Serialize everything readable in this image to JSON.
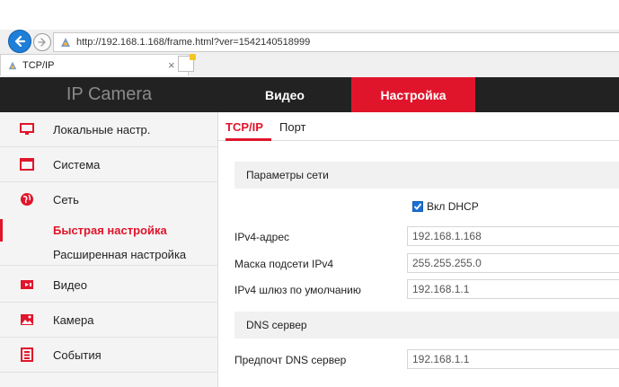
{
  "browser": {
    "address": "http://192.168.1.168/frame.html?ver=1542140518999",
    "tab_title": "TCP/IP",
    "tab_close": "×"
  },
  "header": {
    "brand": "IP Camera",
    "nav": [
      {
        "label": "Видео"
      },
      {
        "label": "Настройка"
      }
    ]
  },
  "sidebar": {
    "items": [
      {
        "label": "Локальные настр.",
        "icon": "monitor-icon"
      },
      {
        "label": "Система",
        "icon": "system-icon"
      },
      {
        "label": "Сеть",
        "icon": "globe-icon"
      },
      {
        "label": "Видео",
        "icon": "video-icon"
      },
      {
        "label": "Камера",
        "icon": "image-icon"
      },
      {
        "label": "События",
        "icon": "events-icon"
      }
    ],
    "subitems": [
      {
        "label": "Быстрая настройка"
      },
      {
        "label": "Расширенная настройка"
      }
    ]
  },
  "content": {
    "tabs": [
      {
        "label": "TCP/IP"
      },
      {
        "label": "Порт"
      }
    ],
    "network_section": "Параметры сети",
    "dhcp_label": "Вкл DHCP",
    "fields": [
      {
        "label": "IPv4-адрес",
        "value": "192.168.1.168"
      },
      {
        "label": "Маска подсети IPv4",
        "value": "255.255.255.0"
      },
      {
        "label": "IPv4 шлюз по умолчанию",
        "value": "192.168.1.1"
      }
    ],
    "dns_section": "DNS сервер",
    "dns_fields": [
      {
        "label": "Предпочт DNS сервер",
        "value": "192.168.1.1"
      }
    ]
  },
  "colors": {
    "accent": "#e0152b",
    "header_bg": "#222222",
    "sidebar_bg": "#f4f4f4"
  }
}
